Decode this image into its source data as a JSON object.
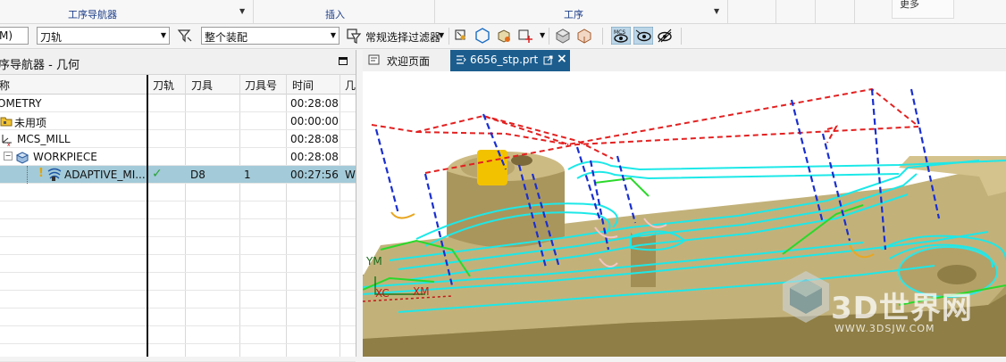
{
  "ribbon": {
    "groups": [
      {
        "label": "工序导航器"
      },
      {
        "label": "插入"
      },
      {
        "label": "工序"
      }
    ],
    "right_button_label": "更多"
  },
  "toolbar": {
    "left_combo_value": "M)",
    "filter_combo_value": "刀轨",
    "assembly_combo_value": "整个装配",
    "selection_filter_label": "常规选择过滤器"
  },
  "navigator": {
    "title": "序导航器 - 几何",
    "columns": [
      "称",
      "刀轨",
      "刀具",
      "刀具号",
      "时间",
      "几"
    ],
    "rows": [
      {
        "name": "OMETRY",
        "path": "",
        "tool": "",
        "tool_no": "",
        "time": "00:28:08",
        "extra": "",
        "icon": "none"
      },
      {
        "name": "未用项",
        "path": "",
        "tool": "",
        "tool_no": "",
        "time": "00:00:00",
        "extra": "",
        "icon": "folder-icon"
      },
      {
        "name": "MCS_MILL",
        "path": "",
        "tool": "",
        "tool_no": "",
        "time": "00:28:08",
        "extra": "",
        "icon": "mcs-icon"
      },
      {
        "name": "WORKPIECE",
        "path": "",
        "tool": "",
        "tool_no": "",
        "time": "00:28:08",
        "extra": "",
        "icon": "workpiece-icon"
      },
      {
        "name": "ADAPTIVE_MI...",
        "path": "✓",
        "tool": "D8",
        "tool_no": "1",
        "time": "00:27:56",
        "extra": "W",
        "icon": "adaptive-milling-icon"
      }
    ]
  },
  "graphics": {
    "tabs": [
      {
        "label": "欢迎页面"
      },
      {
        "label": "6656_stp.prt"
      }
    ],
    "axis_labels": {
      "ym": "YM",
      "xc": "XC",
      "xm": "XM"
    },
    "watermark_text": "3D世界网",
    "watermark_url": "WWW.3DSJW.COM"
  },
  "colors": {
    "accent_tab": "#1c5d8e",
    "selected_row": "#a3cad8",
    "part_color": "#b9a870",
    "toolpath_cyan": "#1de8e8",
    "rapid_red": "#e32020",
    "engage_blue": "#1a2fd0"
  }
}
